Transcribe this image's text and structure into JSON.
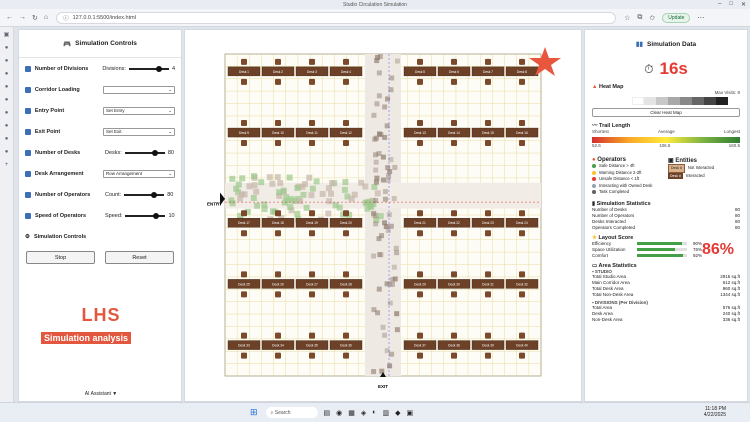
{
  "browser": {
    "title": "Studio Circulation Simulation",
    "url_prefix": "127.0.0.1",
    "url_rest": ":5500/index.html",
    "update_label": "Update"
  },
  "left": {
    "title": "Simulation Controls",
    "controls": [
      {
        "label": "Number of Divisions",
        "sub": "Divisions:",
        "value": "4",
        "type": "slider",
        "fill": 0.8
      },
      {
        "label": "Corridor Loading",
        "type": "select",
        "value": ""
      },
      {
        "label": "Entry Point",
        "type": "select",
        "value": "Set Entry"
      },
      {
        "label": "Exit Point",
        "type": "select",
        "value": "Set Exit"
      },
      {
        "label": "Number of Desks",
        "sub": "Desks:",
        "value": "80",
        "type": "slider",
        "fill": 0.8
      },
      {
        "label": "Desk Arrangement",
        "type": "select",
        "value": "Row Arrangement"
      },
      {
        "label": "Number of Operators",
        "sub": "Count:",
        "value": "80",
        "type": "slider",
        "fill": 0.8
      },
      {
        "label": "Speed of Operators",
        "sub": "Speed:",
        "value": "10",
        "type": "slider",
        "fill": 0.8
      }
    ],
    "sim_controls": "Simulation Controls",
    "stop": "Stop",
    "reset": "Reset",
    "brand": "LHS",
    "tagline": "Simulation analysis",
    "ai": "AI Assistant ▼"
  },
  "center": {
    "entry": "ENTRY",
    "exit": "EXIT",
    "desk_prefix": "Desk"
  },
  "right": {
    "title": "Simulation Data",
    "timer": "16s",
    "heatmap": "Heat Map",
    "max_visits": "Max Visits: 8",
    "clear": "Clear Heat Map",
    "trail": "Trail Length",
    "shortest": "Shortest",
    "average": "Average",
    "longest": "Longest",
    "t_min": "52.6",
    "t_avg": "106.5",
    "t_max": "160.5",
    "operators": "Operators",
    "entities": "Entities",
    "op_legend": [
      {
        "color": "#43a047",
        "label": "Safe Distance > 4ft"
      },
      {
        "color": "#fbc02d",
        "label": "Warning Distance 2-3ft"
      },
      {
        "color": "#e53935",
        "label": "Unsafe Distance < 1ft"
      },
      {
        "color": "#90a4ae",
        "label": "Interacting with Owned Desk"
      },
      {
        "color": "#616161",
        "label": "Task Completed"
      }
    ],
    "ent_legend": [
      {
        "label": "Not Interacted"
      },
      {
        "label": "Interacted"
      }
    ],
    "desk_tag": "Desk #",
    "sim_stats": "Simulation Statistics",
    "stats": [
      [
        "Number of Desks",
        "80"
      ],
      [
        "Number of Operators",
        "80"
      ],
      [
        "Desks Interacted",
        "80"
      ],
      [
        "Operators Completed",
        "80"
      ]
    ],
    "layout": "Layout Score",
    "scores": [
      [
        "Efficiency",
        "90%",
        0.9
      ],
      [
        "Space Utilization",
        "76%",
        0.76
      ],
      [
        "Comfort",
        "92%",
        0.92
      ]
    ],
    "layout_total": "86%",
    "area": "Area Statistics",
    "studio": "STUDIO",
    "studio_rows": [
      [
        "Total Studio Area",
        "2916 sq.ft"
      ],
      [
        "Main Corridor Area",
        "612 sq.ft"
      ],
      [
        "Total Desk Area",
        "960 sq.ft"
      ],
      [
        "Total Non-Desk Area",
        "1344 sq.ft"
      ]
    ],
    "divisions": "DIVISIONS (Per Division)",
    "div_rows": [
      [
        "Total Area",
        "576 sq.ft"
      ],
      [
        "Desk Area",
        "240 sq.ft"
      ],
      [
        "Non-Desk Area",
        "336 sq.ft"
      ]
    ]
  },
  "taskbar": {
    "search": "Search",
    "time": "11:18 PM",
    "date": "4/22/2025"
  }
}
